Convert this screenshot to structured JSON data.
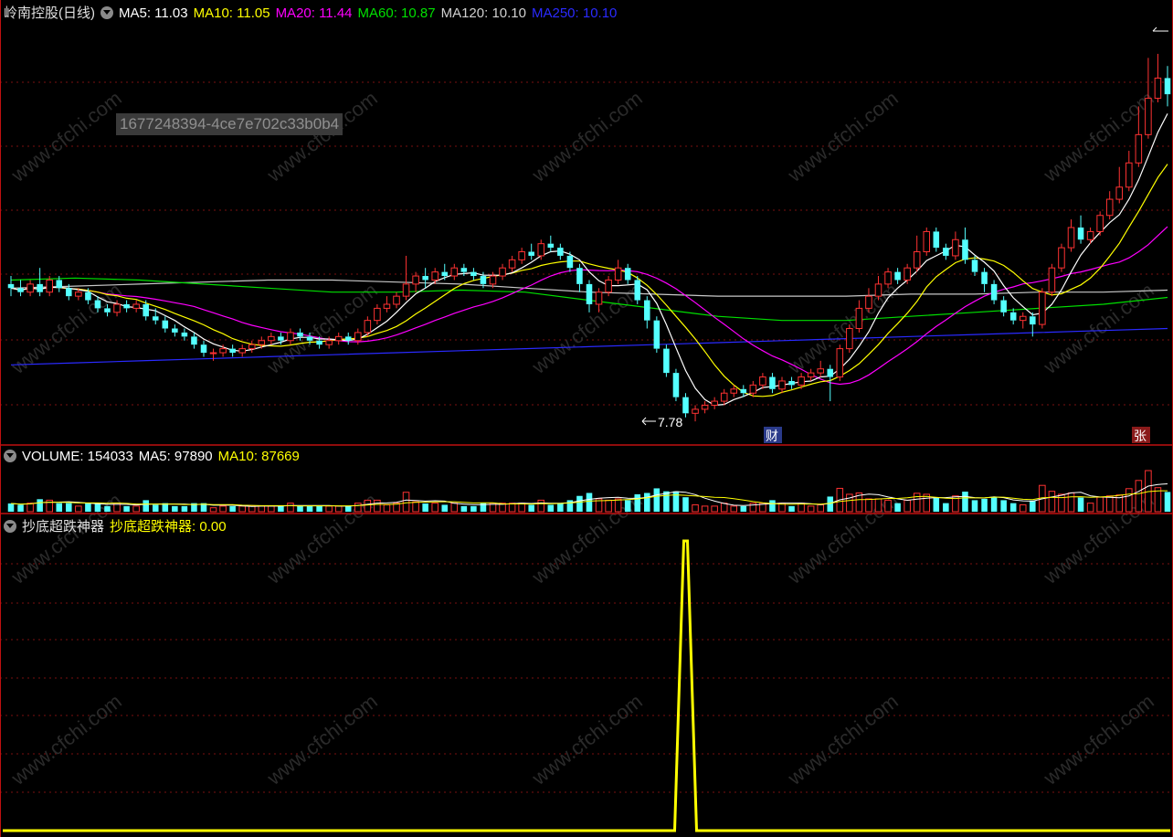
{
  "main_header": {
    "stock_name": "岭南控股(日线)",
    "ma5": "MA5: 11.03",
    "ma10": "MA10: 11.05",
    "ma20": "MA20: 11.44",
    "ma60": "MA60: 10.87",
    "ma120": "MA120: 10.10",
    "ma250": "MA250: 10.10"
  },
  "overlay_id": "1677248394-4ce7e702c33b0b4",
  "annotations": {
    "low_price": "7.78",
    "marker_cai": "财",
    "marker_zhang": "张"
  },
  "volume_header": {
    "volume": "VOLUME: 154033",
    "ma5": "MA5: 97890",
    "ma10": "MA10: 87669"
  },
  "indicator_header": {
    "name": "抄底超跌神器",
    "label": "抄底超跌神器",
    "value": ": 0.00"
  },
  "watermark": "www.cfchi.com",
  "colors": {
    "up": "#ff3232",
    "down": "#54ffff",
    "ma5": "#ffffff",
    "ma10": "#ffff00",
    "ma20": "#ff00ff",
    "ma60": "#00e000",
    "ma120": "#c8c8c8",
    "ma250": "#2a2aff",
    "indicator": "#ffff00",
    "grid": "#7a1010",
    "divider": "#c01010"
  },
  "chart_data": [
    {
      "type": "candlestick",
      "title": "岭南控股(日线)",
      "annotated_low": 7.78,
      "candles": [
        [
          11.2,
          11.1,
          11.4,
          10.9
        ],
        [
          11.1,
          11.0,
          11.3,
          10.9
        ],
        [
          11.0,
          11.2,
          11.3,
          10.9
        ],
        [
          11.2,
          11.0,
          11.6,
          10.9
        ],
        [
          11.0,
          11.3,
          11.4,
          10.9
        ],
        [
          11.3,
          11.1,
          11.4,
          11.0
        ],
        [
          11.1,
          10.9,
          11.2,
          10.8
        ],
        [
          10.9,
          11.0,
          11.1,
          10.8
        ],
        [
          11.0,
          10.8,
          11.1,
          10.7
        ],
        [
          10.8,
          10.6,
          10.9,
          10.5
        ],
        [
          10.6,
          10.5,
          10.7,
          10.4
        ],
        [
          10.5,
          10.7,
          10.8,
          10.4
        ],
        [
          10.7,
          10.6,
          10.8,
          10.5
        ],
        [
          10.6,
          10.7,
          10.8,
          10.5
        ],
        [
          10.7,
          10.4,
          10.8,
          10.3
        ],
        [
          10.4,
          10.3,
          10.6,
          10.2
        ],
        [
          10.3,
          10.1,
          10.4,
          10.0
        ],
        [
          10.1,
          10.0,
          10.2,
          9.9
        ],
        [
          10.0,
          9.9,
          10.1,
          9.8
        ],
        [
          9.9,
          9.7,
          10.0,
          9.6
        ],
        [
          9.7,
          9.5,
          9.8,
          9.4
        ],
        [
          9.5,
          9.5,
          9.6,
          9.3
        ],
        [
          9.5,
          9.6,
          9.7,
          9.4
        ],
        [
          9.6,
          9.5,
          9.7,
          9.4
        ],
        [
          9.5,
          9.6,
          9.7,
          9.4
        ],
        [
          9.6,
          9.7,
          9.8,
          9.5
        ],
        [
          9.7,
          9.8,
          9.9,
          9.6
        ],
        [
          9.8,
          9.9,
          10.0,
          9.7
        ],
        [
          9.9,
          9.8,
          10.0,
          9.7
        ],
        [
          9.8,
          10.0,
          10.1,
          9.7
        ],
        [
          10.0,
          9.9,
          10.1,
          9.8
        ],
        [
          9.9,
          9.8,
          10.0,
          9.7
        ],
        [
          9.8,
          9.7,
          9.9,
          9.6
        ],
        [
          9.7,
          9.8,
          9.9,
          9.6
        ],
        [
          9.8,
          9.9,
          10.0,
          9.7
        ],
        [
          9.9,
          9.8,
          10.0,
          9.7
        ],
        [
          9.8,
          10.0,
          10.1,
          9.7
        ],
        [
          10.0,
          10.3,
          10.4,
          9.9
        ],
        [
          10.3,
          10.6,
          10.7,
          10.2
        ],
        [
          10.6,
          10.7,
          10.9,
          10.5
        ],
        [
          10.7,
          10.9,
          11.0,
          10.6
        ],
        [
          10.9,
          11.2,
          11.9,
          10.8
        ],
        [
          11.2,
          11.4,
          11.5,
          11.0
        ],
        [
          11.4,
          11.3,
          11.6,
          11.1
        ],
        [
          11.3,
          11.5,
          11.6,
          11.2
        ],
        [
          11.5,
          11.4,
          11.7,
          11.3
        ],
        [
          11.4,
          11.6,
          11.7,
          11.3
        ],
        [
          11.6,
          11.5,
          11.7,
          11.4
        ],
        [
          11.5,
          11.4,
          11.6,
          11.3
        ],
        [
          11.4,
          11.2,
          11.5,
          11.1
        ],
        [
          11.2,
          11.4,
          11.5,
          11.1
        ],
        [
          11.4,
          11.6,
          11.7,
          11.3
        ],
        [
          11.6,
          11.8,
          11.9,
          11.5
        ],
        [
          11.8,
          12.0,
          12.1,
          11.7
        ],
        [
          12.0,
          11.9,
          12.2,
          11.8
        ],
        [
          11.9,
          12.2,
          12.3,
          11.8
        ],
        [
          12.2,
          12.1,
          12.4,
          12.0
        ],
        [
          12.1,
          11.9,
          12.2,
          11.8
        ],
        [
          11.9,
          11.6,
          12.0,
          11.5
        ],
        [
          11.6,
          11.2,
          11.7,
          11.0
        ],
        [
          11.2,
          10.7,
          11.3,
          10.5
        ],
        [
          10.7,
          11.0,
          11.1,
          10.5
        ],
        [
          11.0,
          11.3,
          11.4,
          10.9
        ],
        [
          11.3,
          11.6,
          11.8,
          11.2
        ],
        [
          11.6,
          11.3,
          11.7,
          11.2
        ],
        [
          11.3,
          10.8,
          11.4,
          10.7
        ],
        [
          10.8,
          10.3,
          10.9,
          10.1
        ],
        [
          10.3,
          9.6,
          10.4,
          9.5
        ],
        [
          9.6,
          9.0,
          9.7,
          8.9
        ],
        [
          9.0,
          8.4,
          9.1,
          8.3
        ],
        [
          8.4,
          8.0,
          8.5,
          7.9
        ],
        [
          8.0,
          8.1,
          8.2,
          7.8
        ],
        [
          8.1,
          8.2,
          8.3,
          8.0
        ],
        [
          8.2,
          8.3,
          8.4,
          8.1
        ],
        [
          8.3,
          8.5,
          8.6,
          8.2
        ],
        [
          8.5,
          8.6,
          8.7,
          8.4
        ],
        [
          8.6,
          8.5,
          8.7,
          8.4
        ],
        [
          8.5,
          8.7,
          8.8,
          8.4
        ],
        [
          8.7,
          8.9,
          9.0,
          8.6
        ],
        [
          8.9,
          8.6,
          9.0,
          8.5
        ],
        [
          8.6,
          8.8,
          8.9,
          8.5
        ],
        [
          8.8,
          8.7,
          8.9,
          8.6
        ],
        [
          8.7,
          8.9,
          9.0,
          8.6
        ],
        [
          8.9,
          9.0,
          9.1,
          8.8
        ],
        [
          9.0,
          9.1,
          9.3,
          8.9
        ],
        [
          9.1,
          8.9,
          9.2,
          8.3
        ],
        [
          8.9,
          9.6,
          9.7,
          8.8
        ],
        [
          9.6,
          10.1,
          10.2,
          9.5
        ],
        [
          10.1,
          10.6,
          10.8,
          10.0
        ],
        [
          10.6,
          10.9,
          11.1,
          10.5
        ],
        [
          10.9,
          11.2,
          11.4,
          10.8
        ],
        [
          11.2,
          11.5,
          11.6,
          11.1
        ],
        [
          11.5,
          11.3,
          11.6,
          11.2
        ],
        [
          11.3,
          11.6,
          11.7,
          11.2
        ],
        [
          11.6,
          12.0,
          12.4,
          11.5
        ],
        [
          12.0,
          12.5,
          12.6,
          11.9
        ],
        [
          12.5,
          12.1,
          12.6,
          12.0
        ],
        [
          12.1,
          11.9,
          12.2,
          11.8
        ],
        [
          11.9,
          12.3,
          12.5,
          11.8
        ],
        [
          12.3,
          11.8,
          12.6,
          11.7
        ],
        [
          11.8,
          11.5,
          11.9,
          11.4
        ],
        [
          11.5,
          11.2,
          11.6,
          11.0
        ],
        [
          11.2,
          10.8,
          11.3,
          10.7
        ],
        [
          10.8,
          10.5,
          10.9,
          10.4
        ],
        [
          10.5,
          10.3,
          10.6,
          10.2
        ],
        [
          10.3,
          10.4,
          10.5,
          10.1
        ],
        [
          10.4,
          10.2,
          10.5,
          9.9
        ],
        [
          10.2,
          11.0,
          11.1,
          10.1
        ],
        [
          11.0,
          11.6,
          11.7,
          10.9
        ],
        [
          11.6,
          12.1,
          12.2,
          11.5
        ],
        [
          12.1,
          12.6,
          12.8,
          12.0
        ],
        [
          12.6,
          12.3,
          12.9,
          12.2
        ],
        [
          12.3,
          12.5,
          12.6,
          12.2
        ],
        [
          12.5,
          12.9,
          13.0,
          12.4
        ],
        [
          12.9,
          13.3,
          13.5,
          12.8
        ],
        [
          13.3,
          13.6,
          14.1,
          13.2
        ],
        [
          13.6,
          14.2,
          14.5,
          13.5
        ],
        [
          14.2,
          14.9,
          15.6,
          14.1
        ],
        [
          14.9,
          15.8,
          16.8,
          14.8
        ],
        [
          15.8,
          16.3,
          16.9,
          15.7
        ],
        [
          16.3,
          15.9,
          16.6,
          15.6
        ]
      ]
    },
    {
      "type": "line",
      "name": "MA",
      "series": [
        {
          "name": "MA250",
          "values": [
            9.2,
            9.25,
            9.3,
            9.35,
            9.4,
            9.45,
            9.5,
            9.55,
            9.6,
            9.65,
            9.7,
            9.75,
            9.8,
            9.85,
            9.9,
            9.95,
            10.0,
            10.05,
            10.1
          ]
        },
        {
          "name": "MA120",
          "values": [
            11.1,
            11.15,
            11.2,
            11.25,
            11.3,
            11.3,
            11.25,
            11.2,
            11.1,
            11.0,
            10.95,
            10.9,
            10.9,
            10.9,
            10.95,
            10.95,
            11.0,
            11.0,
            11.05
          ]
        },
        {
          "name": "MA60",
          "values": [
            11.3,
            11.35,
            11.3,
            11.2,
            11.1,
            11.0,
            11.0,
            11.05,
            11.0,
            10.8,
            10.6,
            10.4,
            10.3,
            10.3,
            10.4,
            10.5,
            10.6,
            10.7,
            10.87
          ]
        }
      ]
    },
    {
      "type": "bar",
      "name": "VOLUME",
      "values": [
        154033
      ],
      "ma5": 97890,
      "ma10": 87669
    },
    {
      "type": "line",
      "name": "抄底超跌神器",
      "value": 0.0,
      "spike_index": 70,
      "spike_value": 1.0
    }
  ]
}
